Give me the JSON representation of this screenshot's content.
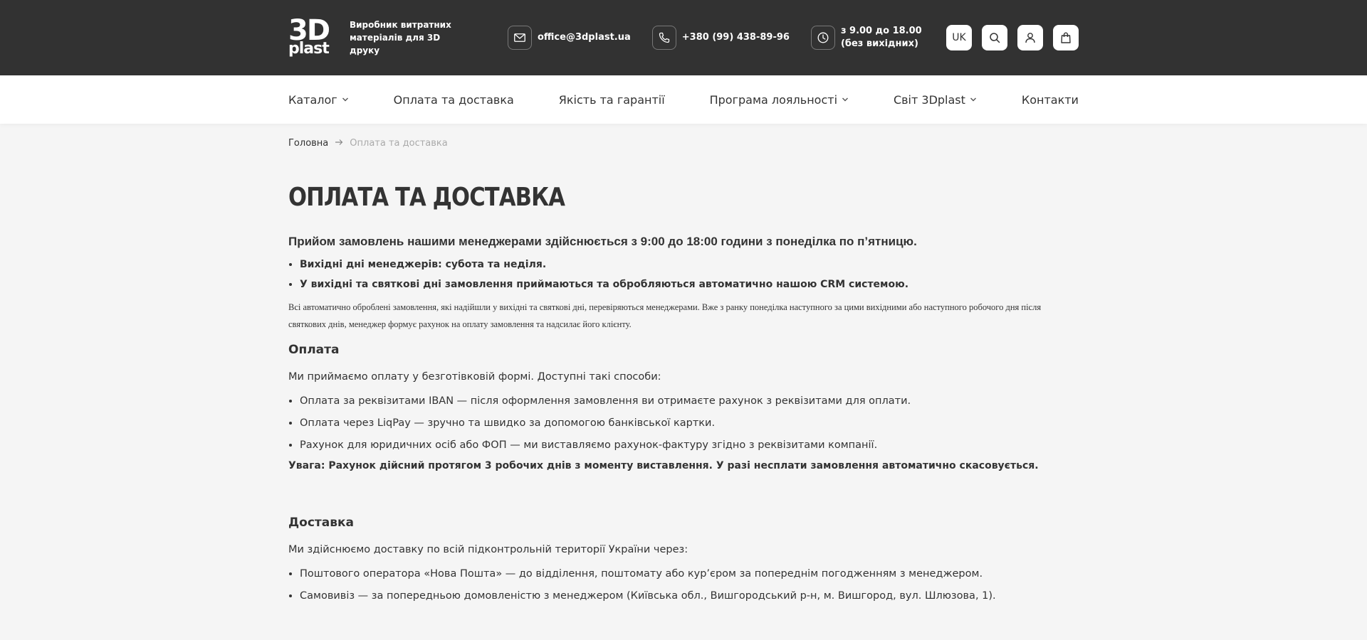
{
  "header": {
    "logo_big": "3D",
    "logo_small": "plast",
    "tagline": "Виробник витратних матеріалів для 3D друку",
    "email": "office@3dplast.ua",
    "phone": "+380 (99) 438-89-96",
    "hours_line1": "з 9.00 до 18.00",
    "hours_line2": "(без вихідних)",
    "lang": "UK"
  },
  "nav": {
    "items": [
      {
        "label": "Каталог",
        "dropdown": true
      },
      {
        "label": "Оплата та доставка",
        "dropdown": false
      },
      {
        "label": "Якість та гарантії",
        "dropdown": false
      },
      {
        "label": "Програма лояльності",
        "dropdown": true
      },
      {
        "label": "Світ 3Dplast",
        "dropdown": true
      },
      {
        "label": "Контакти",
        "dropdown": false
      }
    ]
  },
  "breadcrumb": {
    "home": "Головна",
    "current": "Оплата та доставка"
  },
  "page": {
    "title": "ОПЛАТА ТА ДОСТАВКА",
    "lead": "Прийом замовлень нашими менеджерами здійснюється з 9:00 до 18:00 години з понеділка по п’ятницю.",
    "weekend_items": [
      "Вихідні дні менеджерів: субота та неділя.",
      "У вихідні та святкові дні замовлення приймаються та обробляються автоматично нашою CRM системою."
    ],
    "note": "Всі автоматично оброблені замовлення, які надійшли у вихідні та святкові дні, перевіряються менеджерами. Вже з ранку понеділка наступного за цими вихідними або наступного робочого дня після святкових днів, менеджер формує рахунок на оплату замовлення та надсилає його клієнту.",
    "payment": {
      "title": "Оплата",
      "intro": "Ми приймаємо оплату у безготівковій формі. Доступні такі способи:",
      "items": [
        "Оплата за реквізитами IBAN — після оформлення замовлення ви отримаєте рахунок з реквізитами для оплати.",
        "Оплата через LiqPay — зручно та швидко за допомогою банківської картки.",
        "Рахунок для юридичних осіб або ФОП — ми виставляємо рахунок-фактуру згідно з реквізитами компанії."
      ],
      "warning": "Увага: Рахунок дійсний протягом 3 робочих днів з моменту виставлення. У разі несплати замовлення автоматично скасовується."
    },
    "delivery": {
      "title": "Доставка",
      "intro": "Ми здійснюємо доставку по всій підконтрольній території України через:",
      "items": [
        "Поштового оператора «Нова Пошта» — до відділення, поштомату або кур’єром за попереднім погодженням з менеджером.",
        "Самовивіз — за попередньою домовленістю з менеджером (Київська обл., Вишгородський р-н, м. Вишгород, вул. Шлюзова, 1)."
      ]
    }
  },
  "colors": {
    "topbar": "#323232",
    "page_bg": "#f5f5f5",
    "text": "#333333"
  }
}
